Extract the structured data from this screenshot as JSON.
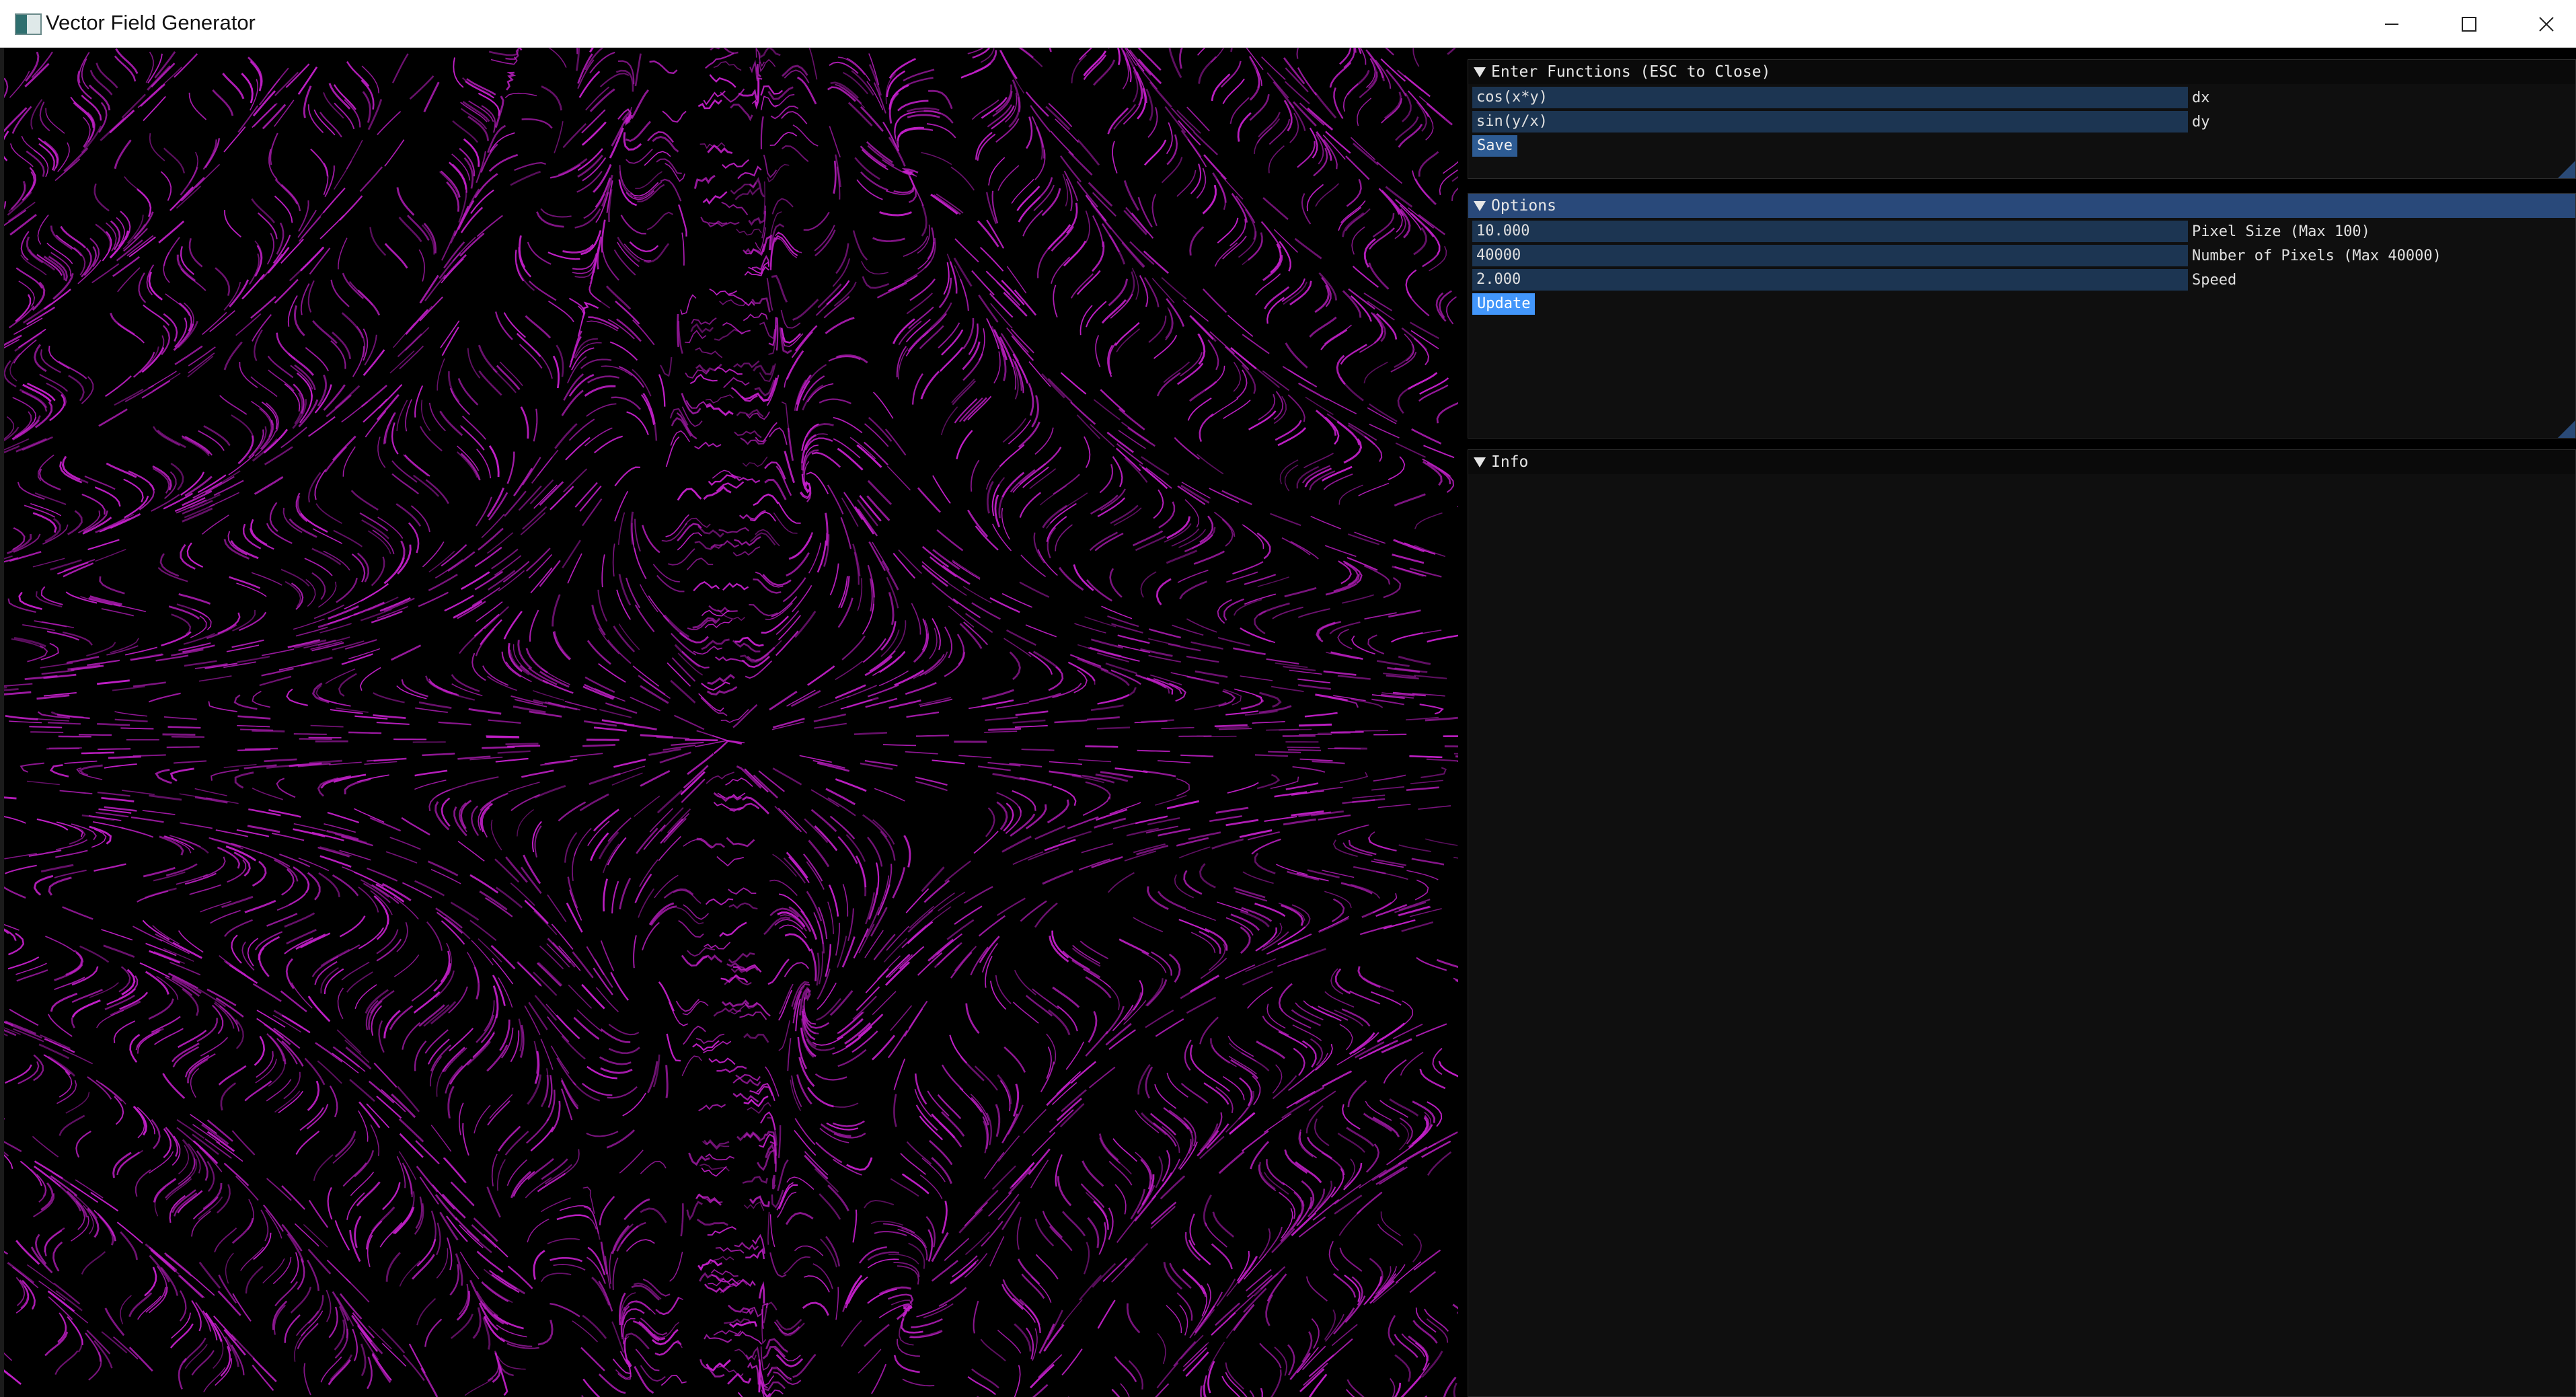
{
  "window": {
    "title": "Vector Field Generator",
    "icon": "app-icon",
    "controls": [
      "minimize-icon",
      "maximize-icon",
      "close-icon"
    ]
  },
  "viewport": {
    "streak_color": "#c21fc8",
    "background": "#000000"
  },
  "functions_panel": {
    "title": "Enter Functions (ESC to Close)",
    "dx_value": "cos(x*y)",
    "dx_label": "dx",
    "dy_value": "sin(y/x)",
    "dy_label": "dy",
    "save_label": "Save"
  },
  "options_panel": {
    "title": "Options",
    "pixel_size_value": "10.000",
    "pixel_size_label": "Pixel Size (Max 100)",
    "num_pixels_value": "40000",
    "num_pixels_label": "Number of Pixels (Max 40000)",
    "speed_value": "2.000",
    "speed_label": "Speed",
    "update_label": "Update"
  },
  "info_panel": {
    "title": "Info"
  },
  "colors": {
    "title_active": "#29497a",
    "frame_bg": "#1c3552",
    "button": "#2d5b93",
    "button_hover": "#4296fa",
    "window_bg": "#0f0f0f"
  }
}
